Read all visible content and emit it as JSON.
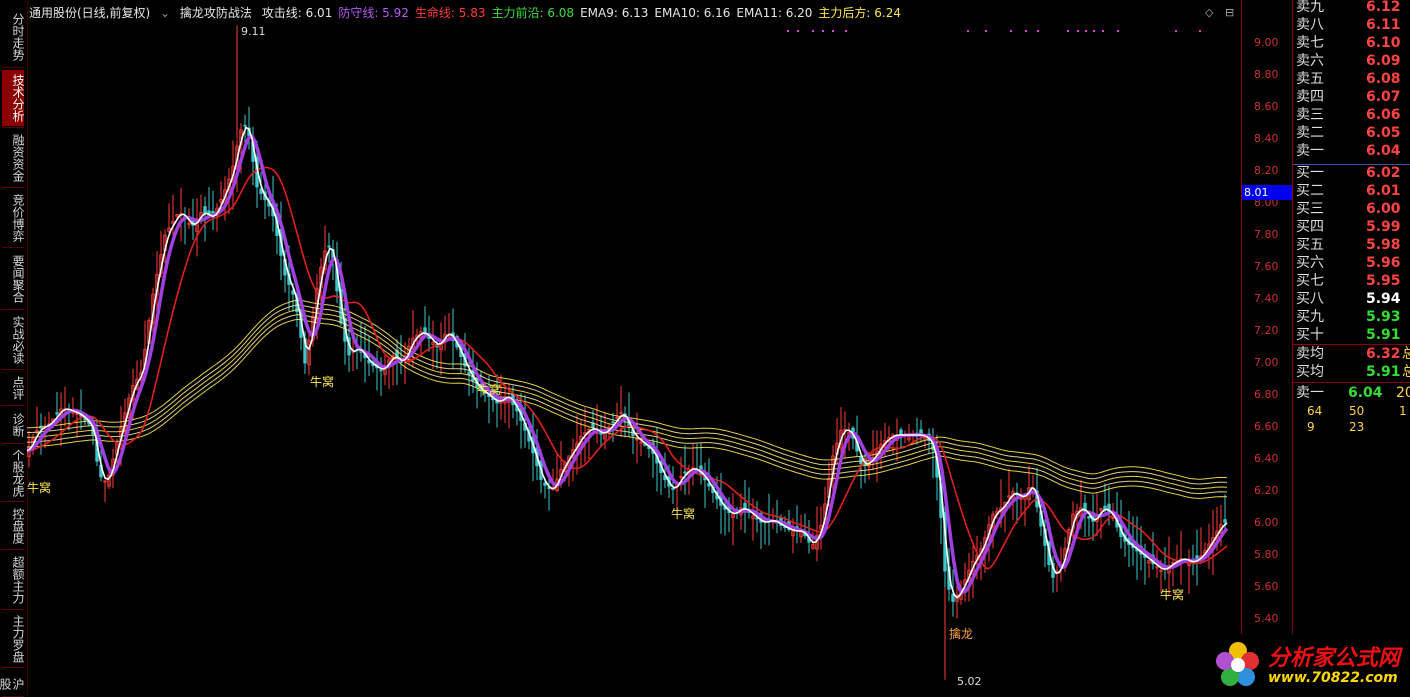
{
  "left_tabs": [
    {
      "label": "分时走势",
      "active": false
    },
    {
      "label": "技术分析",
      "active": true
    },
    {
      "label": "融资资金",
      "active": false
    },
    {
      "label": "竞价博弈",
      "active": false
    },
    {
      "label": "要闻聚合",
      "active": false
    },
    {
      "label": "实战必读",
      "active": false
    },
    {
      "label": "点评",
      "active": false
    },
    {
      "label": "诊断",
      "active": false
    },
    {
      "label": "个股龙虎",
      "active": false
    },
    {
      "label": "控盘度",
      "active": false
    },
    {
      "label": "超额主力",
      "active": false
    },
    {
      "label": "主力罗盘",
      "active": false
    },
    {
      "label": "沪股",
      "active": false
    }
  ],
  "header": {
    "stock_title": "通用股份(日线,前复权)",
    "indicator_name": "擒龙攻防战法",
    "items": [
      {
        "label": "攻击线: 6.01",
        "color": "#e6e6e6"
      },
      {
        "label": "防守线: 5.92",
        "color": "#b45af0"
      },
      {
        "label": "生命线: 5.83",
        "color": "#ff3c3c"
      },
      {
        "label": "主力前沿: 6.08",
        "color": "#3cdc3c"
      },
      {
        "label": "EMA9: 6.13",
        "color": "#e6e6e6"
      },
      {
        "label": "EMA10: 6.16",
        "color": "#e6e6e6"
      },
      {
        "label": "EMA11: 6.20",
        "color": "#e6e6e6"
      },
      {
        "label": "主力后方: 6.24",
        "color": "#ffe650"
      }
    ],
    "icon_diamond": "◇",
    "icon_box": "⊟"
  },
  "y_axis": {
    "ticks": [
      "9.00",
      "8.80",
      "8.60",
      "8.40",
      "8.20",
      "8.00",
      "7.80",
      "7.60",
      "7.40",
      "7.20",
      "7.00",
      "6.80",
      "6.60",
      "6.40",
      "6.20",
      "6.00",
      "5.80",
      "5.60",
      "5.40"
    ],
    "current_marker": "8.01"
  },
  "annotations": {
    "high_label": "9.11",
    "low_label": "5.02",
    "niuwo_labels": [
      "牛窝",
      "牛窝",
      "牛窝",
      "牛窝",
      "牛窝"
    ],
    "qinlong_label": "擒龙"
  },
  "orderbook": {
    "sells": [
      {
        "label": "卖九",
        "price": "6.12"
      },
      {
        "label": "卖八",
        "price": "6.11"
      },
      {
        "label": "卖七",
        "price": "6.10"
      },
      {
        "label": "卖六",
        "price": "6.09"
      },
      {
        "label": "卖五",
        "price": "6.08"
      },
      {
        "label": "卖四",
        "price": "6.07"
      },
      {
        "label": "卖三",
        "price": "6.06"
      },
      {
        "label": "卖二",
        "price": "6.05"
      },
      {
        "label": "卖一",
        "price": "6.04"
      }
    ],
    "buys": [
      {
        "label": "买一",
        "price": "6.02",
        "color": "#ff4444"
      },
      {
        "label": "买二",
        "price": "6.01",
        "color": "#ff4444"
      },
      {
        "label": "买三",
        "price": "6.00",
        "color": "#ff4444"
      },
      {
        "label": "买四",
        "price": "5.99",
        "color": "#ff4444"
      },
      {
        "label": "买五",
        "price": "5.98",
        "color": "#ff4444"
      },
      {
        "label": "买六",
        "price": "5.96",
        "color": "#ff4444"
      },
      {
        "label": "买七",
        "price": "5.95",
        "color": "#ff4444"
      },
      {
        "label": "买八",
        "price": "5.94",
        "color": "#ffffff"
      },
      {
        "label": "买九",
        "price": "5.93",
        "color": "#33dd33"
      },
      {
        "label": "买十",
        "price": "5.91",
        "color": "#33dd33"
      }
    ],
    "avg": [
      {
        "label": "卖均",
        "price": "6.32",
        "suffix": "总",
        "color": "#ff4444"
      },
      {
        "label": "买均",
        "price": "5.91",
        "suffix": "总",
        "color": "#33dd33"
      }
    ],
    "sell_one": {
      "label": "卖一",
      "price": "6.04",
      "extra": "20"
    },
    "small_rows": [
      [
        "64",
        "50",
        "1"
      ],
      [
        "9",
        "23",
        ""
      ]
    ]
  },
  "logo": {
    "text": "分析家公式网",
    "url": "www.70822.com"
  },
  "colors": {
    "up": "#ff3c3c",
    "down": "#3cc8c8",
    "attack": "#ffffff",
    "defense": "#a040e0",
    "life": "#e02020",
    "rear": "#ffe650"
  },
  "chart_data": {
    "type": "line",
    "price_range": [
      5.02,
      9.11
    ],
    "series": [
      {
        "name": "攻击线",
        "last": 6.01
      },
      {
        "name": "防守线",
        "last": 5.92
      },
      {
        "name": "生命线",
        "last": 5.83
      },
      {
        "name": "主力后方",
        "last": 6.24
      }
    ]
  }
}
